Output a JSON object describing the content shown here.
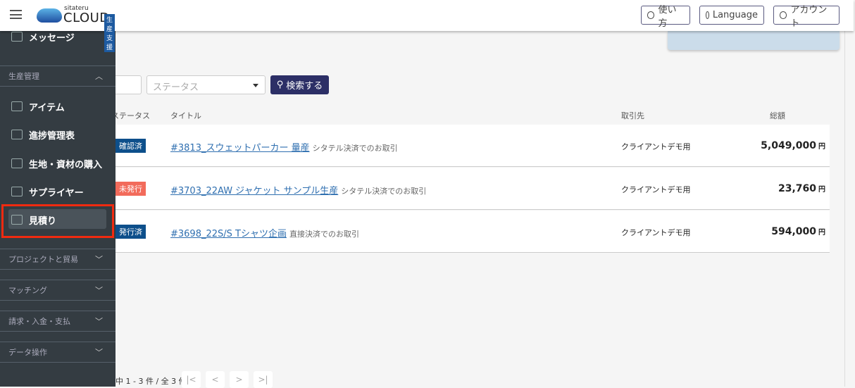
{
  "header": {
    "brand_small": "sitateru",
    "brand": "CLOUD",
    "brand_tag": "生産支援",
    "help": "使い方",
    "language": "Language",
    "account": "アカウント"
  },
  "sidebar": {
    "top_item": "メッセージ",
    "sections": [
      {
        "label": "生産管理",
        "expanded": true,
        "items": [
          "アイテム",
          "進捗管理表",
          "生地・資材の購入",
          "サプライヤー",
          "見積り"
        ]
      },
      {
        "label": "プロジェクトと貿易",
        "expanded": false
      },
      {
        "label": "マッチング",
        "expanded": false
      },
      {
        "label": "請求・入金・支払",
        "expanded": false
      },
      {
        "label": "データ操作",
        "expanded": false
      }
    ],
    "selected": "見積り"
  },
  "filters": {
    "status_placeholder": "ステータス",
    "search_label": "検索する"
  },
  "table": {
    "headers": [
      "ステータス",
      "タイトル",
      "取引先",
      "総額"
    ],
    "rows": [
      {
        "status": "確認済",
        "status_color": "#0d4f8b",
        "title": "#3813_スウェットパーカー 量産",
        "note": "シタテル決済でのお取引",
        "client": "クライアントデモ用",
        "amount": "5,049,000",
        "unit": "円"
      },
      {
        "status": "未発行",
        "status_color": "#f26b5b",
        "title": "#3703_22AW ジャケット サンプル生産",
        "note": "シタテル決済でのお取引",
        "client": "クライアントデモ用",
        "amount": "23,760",
        "unit": "円"
      },
      {
        "status": "発行済",
        "status_color": "#0d4f8b",
        "title": "#3698_22S/S Tシャツ企画",
        "note": "直接決済でのお取引",
        "client": "クライアントデモ用",
        "amount": "594,000",
        "unit": "円"
      }
    ]
  },
  "pagination": {
    "summary": "中 1 - 3 件 / 全 3 件",
    "first": "|<",
    "prev": "<",
    "next": ">",
    "last": ">|"
  }
}
